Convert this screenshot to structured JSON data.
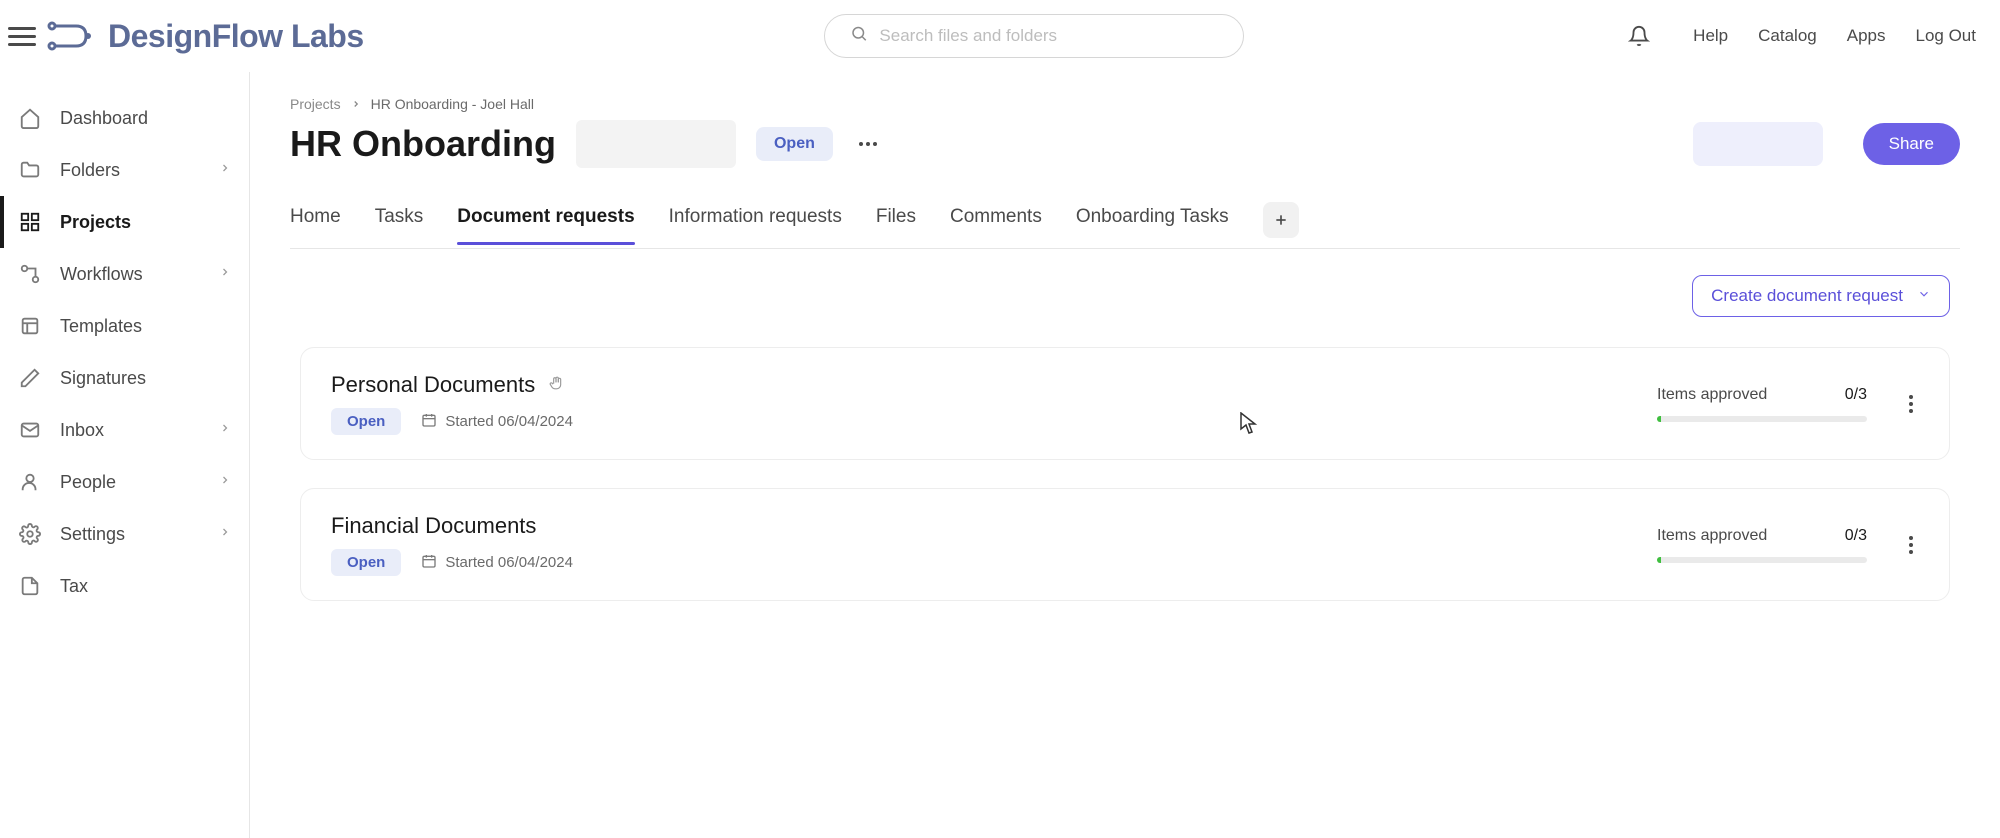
{
  "brand": {
    "name": "DesignFlow Labs"
  },
  "search": {
    "placeholder": "Search files and folders"
  },
  "top_nav": {
    "help": "Help",
    "catalog": "Catalog",
    "apps": "Apps",
    "logout": "Log Out"
  },
  "sidebar": {
    "items": [
      {
        "label": "Dashboard",
        "icon": "home",
        "chevron": false,
        "active": false
      },
      {
        "label": "Folders",
        "icon": "folder",
        "chevron": true,
        "active": false
      },
      {
        "label": "Projects",
        "icon": "projects",
        "chevron": false,
        "active": true
      },
      {
        "label": "Workflows",
        "icon": "workflow",
        "chevron": true,
        "active": false
      },
      {
        "label": "Templates",
        "icon": "template",
        "chevron": false,
        "active": false
      },
      {
        "label": "Signatures",
        "icon": "pen",
        "chevron": false,
        "active": false
      },
      {
        "label": "Inbox",
        "icon": "mail",
        "chevron": true,
        "active": false
      },
      {
        "label": "People",
        "icon": "person",
        "chevron": true,
        "active": false
      },
      {
        "label": "Settings",
        "icon": "gear",
        "chevron": true,
        "active": false
      },
      {
        "label": "Tax",
        "icon": "doc",
        "chevron": false,
        "active": false
      }
    ]
  },
  "breadcrumb": {
    "root": "Projects",
    "current": "HR Onboarding - Joel Hall"
  },
  "page": {
    "title": "HR Onboarding",
    "status": "Open",
    "share": "Share"
  },
  "tabs": [
    {
      "label": "Home",
      "active": false
    },
    {
      "label": "Tasks",
      "active": false
    },
    {
      "label": "Document requests",
      "active": true
    },
    {
      "label": "Information requests",
      "active": false
    },
    {
      "label": "Files",
      "active": false
    },
    {
      "label": "Comments",
      "active": false
    },
    {
      "label": "Onboarding Tasks",
      "active": false
    }
  ],
  "actions": {
    "create": "Create document request"
  },
  "requests": [
    {
      "title": "Personal Documents",
      "status": "Open",
      "started_label": "Started 06/04/2024",
      "approved_label": "Items approved",
      "approved_count": "0/3",
      "progress_pct": 2,
      "show_hand": true
    },
    {
      "title": "Financial Documents",
      "status": "Open",
      "started_label": "Started 06/04/2024",
      "approved_label": "Items approved",
      "approved_count": "0/3",
      "progress_pct": 2,
      "show_hand": false
    }
  ]
}
